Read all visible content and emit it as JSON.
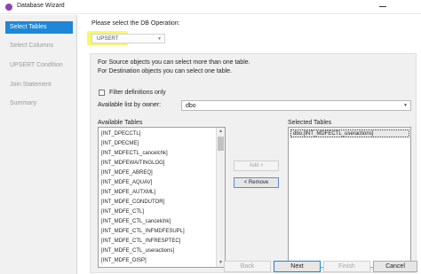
{
  "window": {
    "title": "Database Wizard"
  },
  "sidebar": {
    "items": [
      {
        "label": "Select Tables",
        "active": true
      },
      {
        "label": "Select Columns",
        "active": false
      },
      {
        "label": "UPSERT Condition",
        "active": false
      },
      {
        "label": "Join Statement",
        "active": false
      },
      {
        "label": "Summary",
        "active": false
      }
    ]
  },
  "operation": {
    "label": "Please select the DB Operation:",
    "value": "UPSERT",
    "highlight_color": "#f5f733"
  },
  "info": {
    "line1": "For Source objects you can select more than one table.",
    "line2": "For Destination objects you can select one table."
  },
  "filter": {
    "label": "Filter definitions only",
    "checked": false
  },
  "owner": {
    "label": "Available list by owner:",
    "value": "dbo"
  },
  "available": {
    "label": "Available Tables",
    "items": [
      "[INT_DPECCTL]",
      "[INT_DPECME]",
      "[INT_MDFECTL_cancelchk]",
      "[INT_MDFEWAITINGLOG]",
      "[INT_MDFE_ABREQ]",
      "[INT_MDFE_AQUAV]",
      "[INT_MDFE_AUTXML]",
      "[INT_MDFE_CONDUTOR]",
      "[INT_MDFE_CTL]",
      "[INT_MDFE_CTL_cancelchk]",
      "[INT_MDFE_CTL_INFMDFESUPL]",
      "[INT_MDFE_CTL_INFRESPTEC]",
      "[INT_MDFE_CTL_useractions]",
      "[INT_MDFE_DISP]"
    ]
  },
  "selected": {
    "label": "Selected Tables",
    "items": [
      "dbo.[INT_MDFECTL_useractions]"
    ]
  },
  "buttons": {
    "add": "Add >",
    "remove": "< Remove"
  },
  "footer": {
    "back": "Back",
    "next": "Next",
    "finish": "Finish",
    "cancel": "Cancel"
  },
  "colors": {
    "accent": "#1f87d8"
  }
}
